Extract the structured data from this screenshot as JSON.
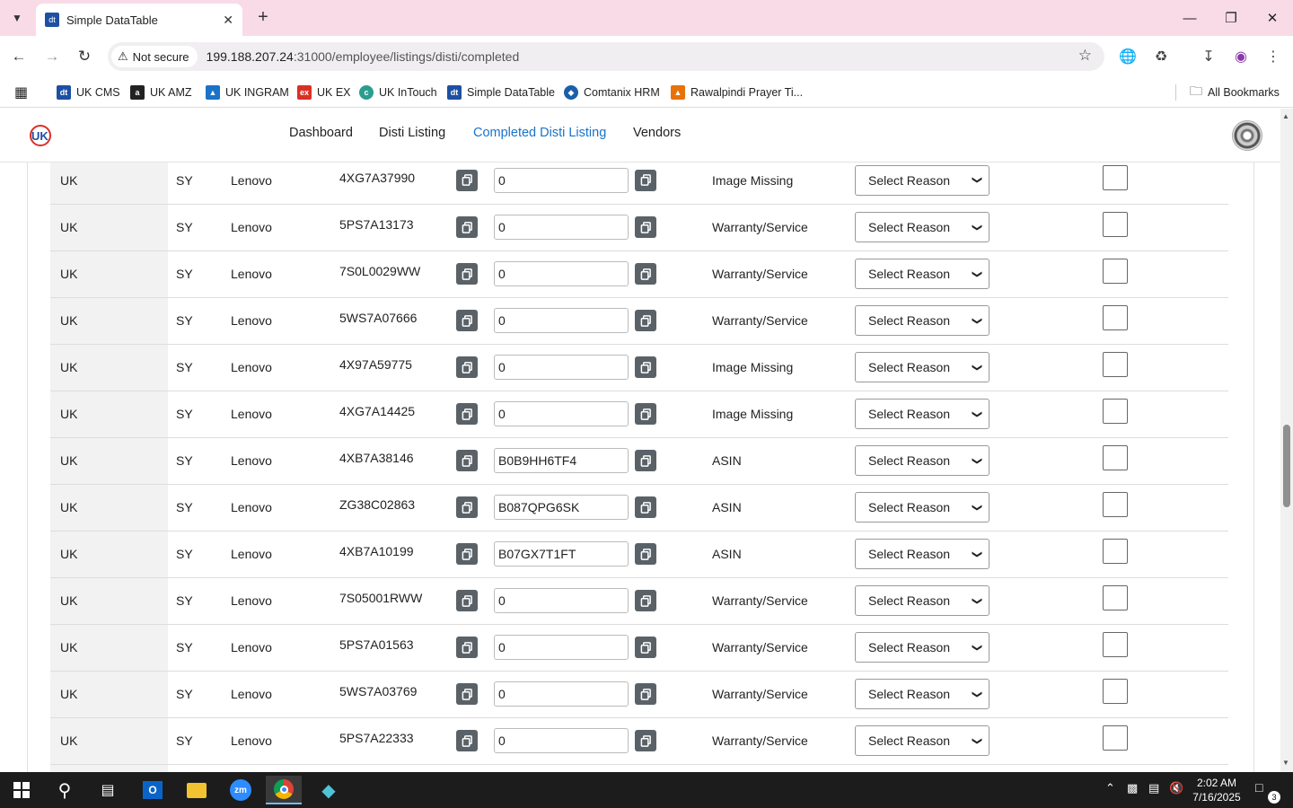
{
  "browser": {
    "tab_title": "Simple DataTable",
    "tab_favicon_text": "dt",
    "security_label": "Not secure",
    "url_host": "199.188.207.24",
    "url_rest": ":31000/employee/listings/disti/completed"
  },
  "bookmarks": [
    {
      "label": "UK CMS",
      "icon": "dt-icon",
      "color": "#1e4fa3"
    },
    {
      "label": "UK AMZ",
      "icon": "amazon-icon",
      "color": "#222222"
    },
    {
      "label": "UK INGRAM",
      "icon": "ingram-icon",
      "color": "#1a73c8"
    },
    {
      "label": "UK EX",
      "icon": "ex-icon",
      "color": "#d93025"
    },
    {
      "label": "UK InTouch",
      "icon": "intouch-icon",
      "color": "#2a9d8f"
    },
    {
      "label": "Simple DataTable",
      "icon": "dt-icon",
      "color": "#1e4fa3"
    },
    {
      "label": "Comtanix HRM",
      "icon": "comtanix-icon",
      "color": "#1a5fa8"
    },
    {
      "label": "Rawalpindi Prayer Ti...",
      "icon": "prayer-icon",
      "color": "#e8710a"
    }
  ],
  "all_bookmarks_label": "All Bookmarks",
  "nav": {
    "links": [
      "Dashboard",
      "Disti Listing",
      "Completed Disti Listing",
      "Vendors"
    ],
    "active_index": 2,
    "accent_color": "#1a73c8"
  },
  "table": {
    "rows": [
      {
        "country": "UK",
        "supplier": "SY",
        "brand": "Lenovo",
        "part": "4XG7A37990",
        "asin": "0",
        "status": "Image Missing",
        "reason": "Select Reason",
        "checked": false
      },
      {
        "country": "UK",
        "supplier": "SY",
        "brand": "Lenovo",
        "part": "5PS7A13173",
        "asin": "0",
        "status": "Warranty/Service",
        "reason": "Select Reason",
        "checked": false
      },
      {
        "country": "UK",
        "supplier": "SY",
        "brand": "Lenovo",
        "part": "7S0L0029WW",
        "asin": "0",
        "status": "Warranty/Service",
        "reason": "Select Reason",
        "checked": false
      },
      {
        "country": "UK",
        "supplier": "SY",
        "brand": "Lenovo",
        "part": "5WS7A07666",
        "asin": "0",
        "status": "Warranty/Service",
        "reason": "Select Reason",
        "checked": false
      },
      {
        "country": "UK",
        "supplier": "SY",
        "brand": "Lenovo",
        "part": "4X97A59775",
        "asin": "0",
        "status": "Image Missing",
        "reason": "Select Reason",
        "checked": false
      },
      {
        "country": "UK",
        "supplier": "SY",
        "brand": "Lenovo",
        "part": "4XG7A14425",
        "asin": "0",
        "status": "Image Missing",
        "reason": "Select Reason",
        "checked": false
      },
      {
        "country": "UK",
        "supplier": "SY",
        "brand": "Lenovo",
        "part": "4XB7A38146",
        "asin": "B0B9HH6TF4",
        "status": "ASIN",
        "reason": "Select Reason",
        "checked": false
      },
      {
        "country": "UK",
        "supplier": "SY",
        "brand": "Lenovo",
        "part": "ZG38C02863",
        "asin": "B087QPG6SK",
        "status": "ASIN",
        "reason": "Select Reason",
        "checked": false
      },
      {
        "country": "UK",
        "supplier": "SY",
        "brand": "Lenovo",
        "part": "4XB7A10199",
        "asin": "B07GX7T1FT",
        "status": "ASIN",
        "reason": "Select Reason",
        "checked": false
      },
      {
        "country": "UK",
        "supplier": "SY",
        "brand": "Lenovo",
        "part": "7S05001RWW",
        "asin": "0",
        "status": "Warranty/Service",
        "reason": "Select Reason",
        "checked": false
      },
      {
        "country": "UK",
        "supplier": "SY",
        "brand": "Lenovo",
        "part": "5PS7A01563",
        "asin": "0",
        "status": "Warranty/Service",
        "reason": "Select Reason",
        "checked": false
      },
      {
        "country": "UK",
        "supplier": "SY",
        "brand": "Lenovo",
        "part": "5WS7A03769",
        "asin": "0",
        "status": "Warranty/Service",
        "reason": "Select Reason",
        "checked": false
      },
      {
        "country": "UK",
        "supplier": "SY",
        "brand": "Lenovo",
        "part": "5PS7A22333",
        "asin": "0",
        "status": "Warranty/Service",
        "reason": "Select Reason",
        "checked": false
      },
      {
        "country": "",
        "supplier": "",
        "brand": "",
        "part": "",
        "asin": "",
        "status": "",
        "reason": "",
        "checked": false
      }
    ]
  },
  "taskbar": {
    "time": "2:02 AM",
    "date": "7/16/2025",
    "notification_count": "3"
  }
}
